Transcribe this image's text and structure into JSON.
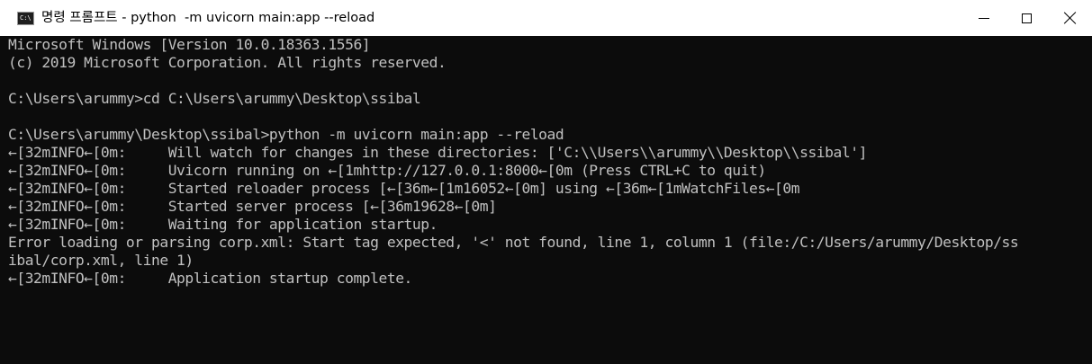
{
  "window": {
    "icon_text": "C:\\",
    "title": "명령 프롬프트 - python  -m uvicorn main:app --reload"
  },
  "console": {
    "lines": [
      "Microsoft Windows [Version 10.0.18363.1556]",
      "(c) 2019 Microsoft Corporation. All rights reserved.",
      "",
      "C:\\Users\\arummy>cd C:\\Users\\arummy\\Desktop\\ssibal",
      "",
      "C:\\Users\\arummy\\Desktop\\ssibal>python -m uvicorn main:app --reload",
      "←[32mINFO←[0m:     Will watch for changes in these directories: ['C:\\\\Users\\\\arummy\\\\Desktop\\\\ssibal']",
      "←[32mINFO←[0m:     Uvicorn running on ←[1mhttp://127.0.0.1:8000←[0m (Press CTRL+C to quit)",
      "←[32mINFO←[0m:     Started reloader process [←[36m←[1m16052←[0m] using ←[36m←[1mWatchFiles←[0m",
      "←[32mINFO←[0m:     Started server process [←[36m19628←[0m]",
      "←[32mINFO←[0m:     Waiting for application startup.",
      "Error loading or parsing corp.xml: Start tag expected, '<' not found, line 1, column 1 (file:/C:/Users/arummy/Desktop/ss",
      "ibal/corp.xml, line 1)",
      "←[32mINFO←[0m:     Application startup complete."
    ]
  }
}
